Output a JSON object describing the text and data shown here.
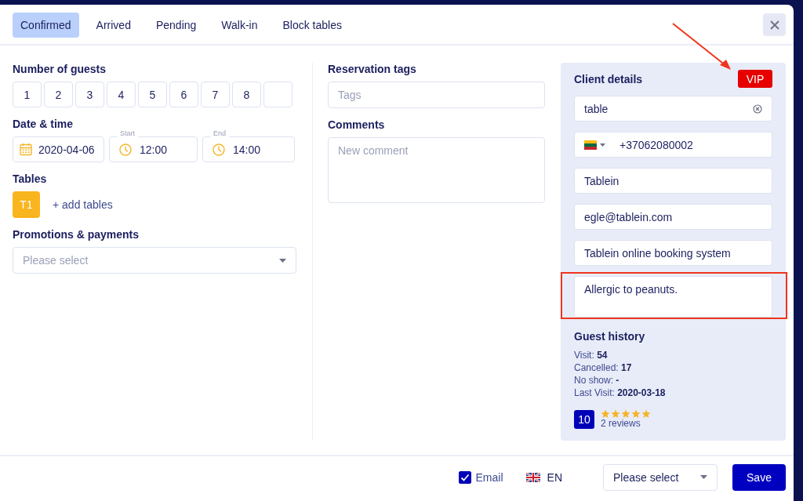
{
  "tabs": [
    {
      "label": "Confirmed",
      "selected": true
    },
    {
      "label": "Arrived",
      "selected": false
    },
    {
      "label": "Pending",
      "selected": false
    },
    {
      "label": "Walk-in",
      "selected": false
    },
    {
      "label": "Block tables",
      "selected": false
    }
  ],
  "guests": {
    "label": "Number of guests",
    "options": [
      {
        "kind": "number",
        "label": "1",
        "selected": false
      },
      {
        "kind": "number",
        "label": "2",
        "selected": false
      },
      {
        "kind": "number",
        "label": "3",
        "selected": false
      },
      {
        "kind": "number",
        "label": "4",
        "selected": false
      },
      {
        "kind": "number",
        "label": "5",
        "selected": false
      },
      {
        "kind": "number",
        "label": "6",
        "selected": false
      },
      {
        "kind": "number",
        "label": "7",
        "selected": false
      },
      {
        "kind": "number",
        "label": "8",
        "selected": false
      },
      {
        "kind": "custom",
        "selected": false
      }
    ]
  },
  "date_time": {
    "label": "Date & time",
    "date": "2020-04-06",
    "start": {
      "label": "Start",
      "value": "12:00"
    },
    "end": {
      "label": "End",
      "value": "14:00"
    }
  },
  "tables": {
    "label": "Tables",
    "items": [
      "T1"
    ],
    "add_link": "+ add tables"
  },
  "promotions": {
    "label": "Promotions & payments",
    "placeholder": "Please select"
  },
  "reservation_tags": {
    "label": "Reservation tags",
    "placeholder": "Tags"
  },
  "comments": {
    "label": "Comments",
    "placeholder": "New comment"
  },
  "client": {
    "title": "Client details",
    "badge": "VIP",
    "search": "table",
    "phone": "+37062080002",
    "name": "Tablein",
    "email": "egle@tablein.com",
    "company": "Tablein online booking system",
    "note": "Allergic to peanuts."
  },
  "guest_history": {
    "title": "Guest history",
    "lines": [
      "Visit: **54**",
      "Cancelled: **17**",
      "No show: **-**",
      "Last Visit: **2020-03-18**"
    ],
    "rating": "10",
    "stars": 5,
    "reviews": "2 reviews"
  },
  "footer": {
    "email": {
      "label": "Email",
      "checked": true
    },
    "language": "EN",
    "select": {
      "value": "Please select"
    },
    "save": "Save"
  }
}
